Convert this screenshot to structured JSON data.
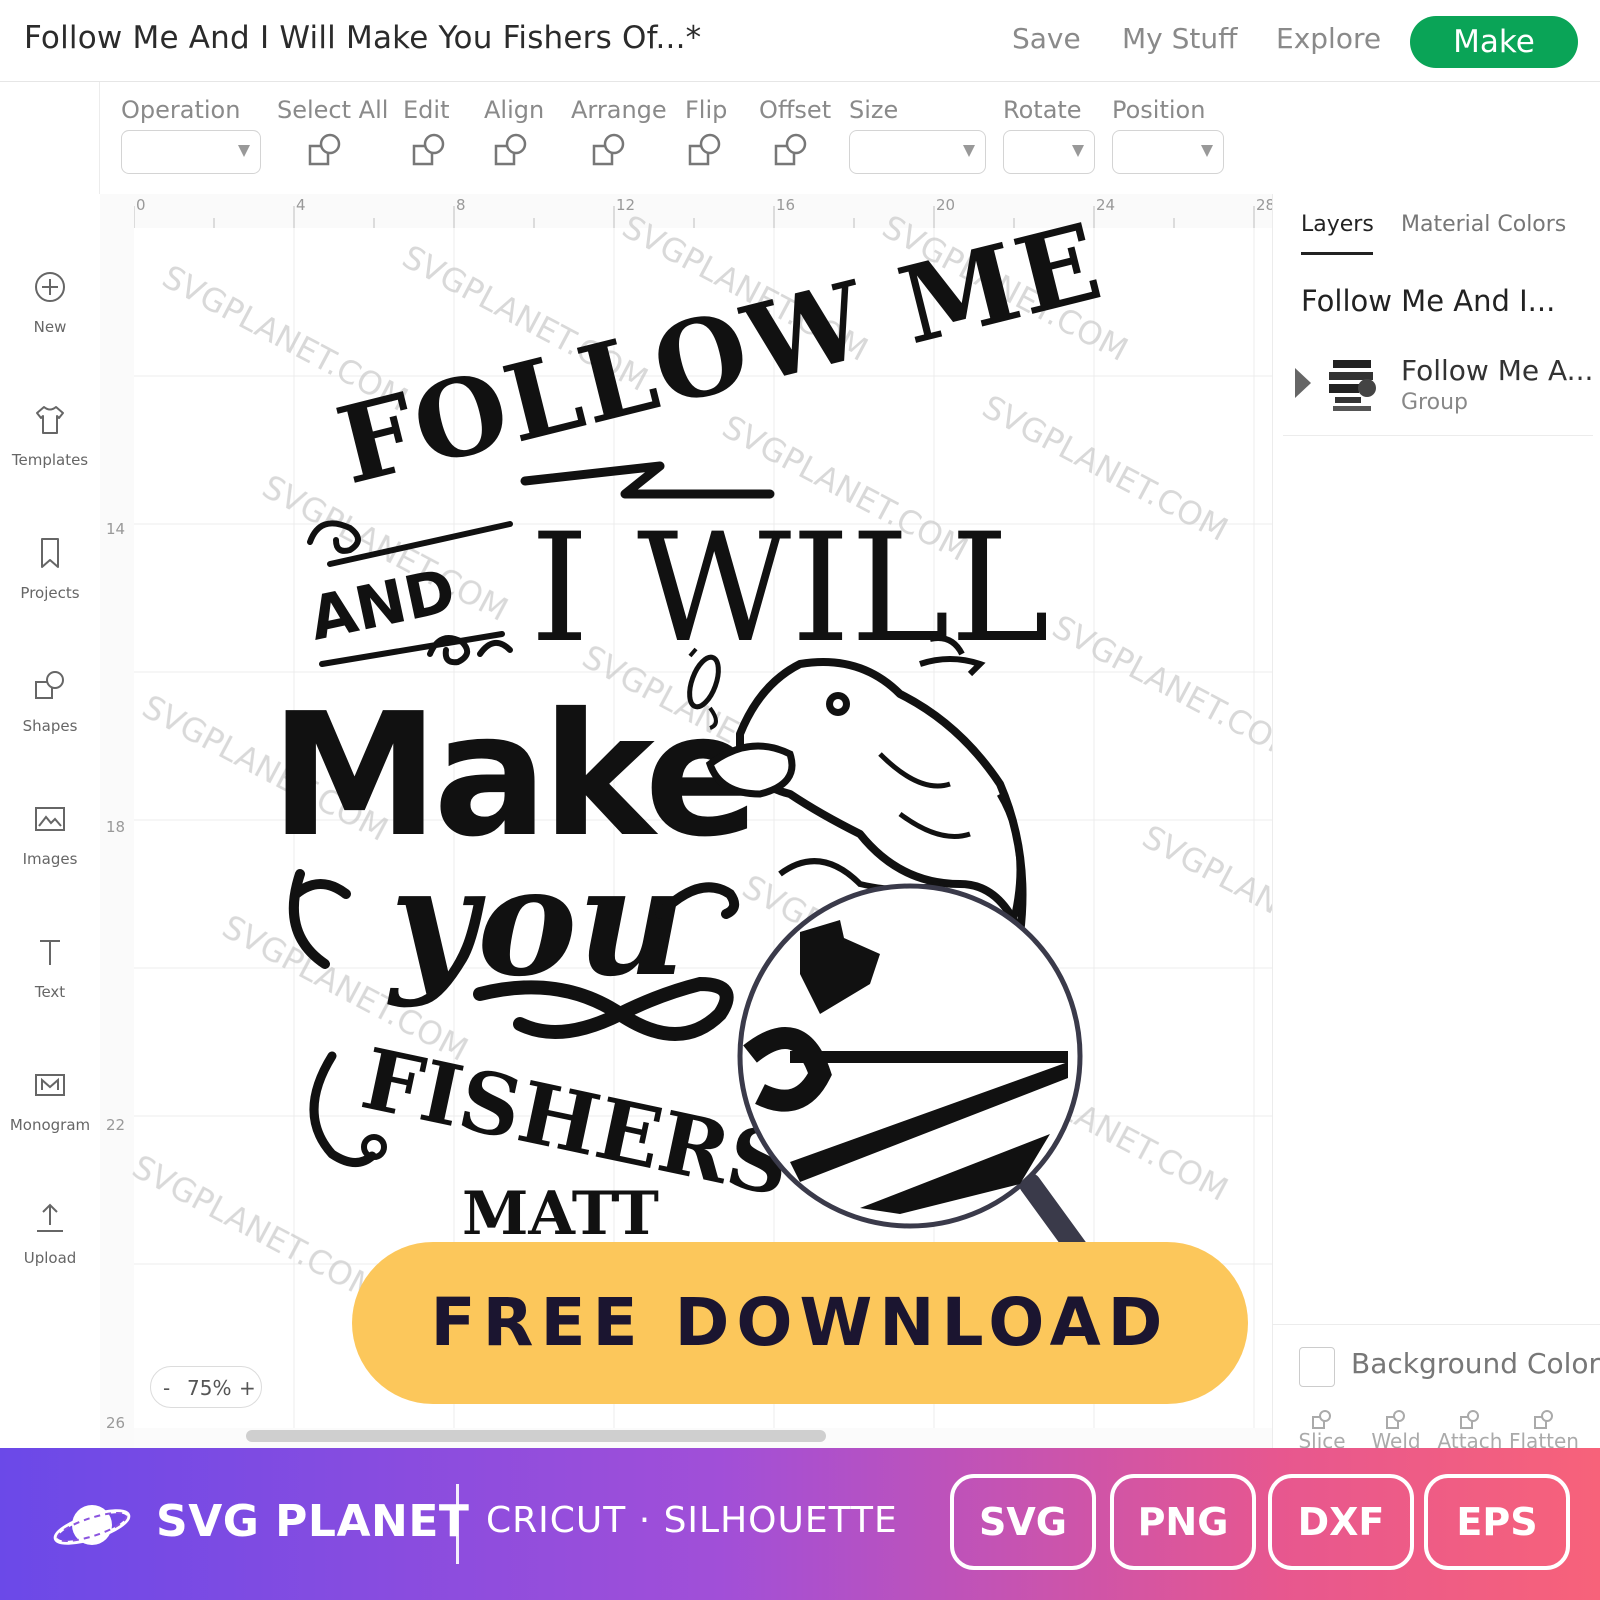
{
  "header": {
    "title": "Follow Me And I Will Make You Fishers Of...*",
    "nav": [
      "Save",
      "My Stuff",
      "Explore"
    ],
    "make_label": "Make"
  },
  "toolbar": {
    "operation": "Operation",
    "select_all": "Select All",
    "edit": "Edit",
    "align": "Align",
    "arrange": "Arrange",
    "flip": "Flip",
    "offset": "Offset",
    "size": "Size",
    "rotate": "Rotate",
    "position": "Position"
  },
  "sidebar": {
    "items": [
      {
        "label": "New",
        "icon": "plus-circle-icon"
      },
      {
        "label": "Templates",
        "icon": "shirt-icon"
      },
      {
        "label": "Projects",
        "icon": "bookmark-icon"
      },
      {
        "label": "Shapes",
        "icon": "shapes-icon"
      },
      {
        "label": "Images",
        "icon": "image-icon"
      },
      {
        "label": "Text",
        "icon": "text-icon"
      },
      {
        "label": "Monogram",
        "icon": "monogram-icon"
      },
      {
        "label": "Upload",
        "icon": "upload-icon"
      }
    ]
  },
  "canvas": {
    "ruler_top": [
      "0",
      "4",
      "8",
      "12",
      "16",
      "20",
      "24",
      "28"
    ],
    "ruler_left": [
      "14",
      "18",
      "22",
      "26"
    ],
    "watermark": "SVGPLANET.COM",
    "design_text": {
      "line1": "FOLLOW ME",
      "line2a": "AND",
      "line2b": "I WILL",
      "line3": "Make",
      "line4": "you",
      "line5": "FISHERS OF",
      "line6": "MATT"
    },
    "zoom": {
      "minus": "-",
      "value": "75%",
      "plus": "+"
    }
  },
  "right_panel": {
    "tabs": [
      "Layers",
      "Material Colors"
    ],
    "layer_group_title": "Follow Me And I...",
    "layer": {
      "name": "Follow Me A...",
      "type": "Group"
    },
    "background_label": "Background Color",
    "tools": [
      "Slice",
      "Weld",
      "Attach",
      "Flatten"
    ]
  },
  "promo": {
    "button": "FREE DOWNLOAD"
  },
  "footer": {
    "brand": "SVG PLANET",
    "compat": "CRICUT  ·  SILHOUETTE",
    "formats": [
      "SVG",
      "PNG",
      "DXF",
      "EPS"
    ]
  },
  "colors": {
    "make_green": "#0aa457",
    "promo_yellow": "#fcc75b",
    "footer_start": "#6b49e8",
    "footer_end": "#f7627a"
  }
}
